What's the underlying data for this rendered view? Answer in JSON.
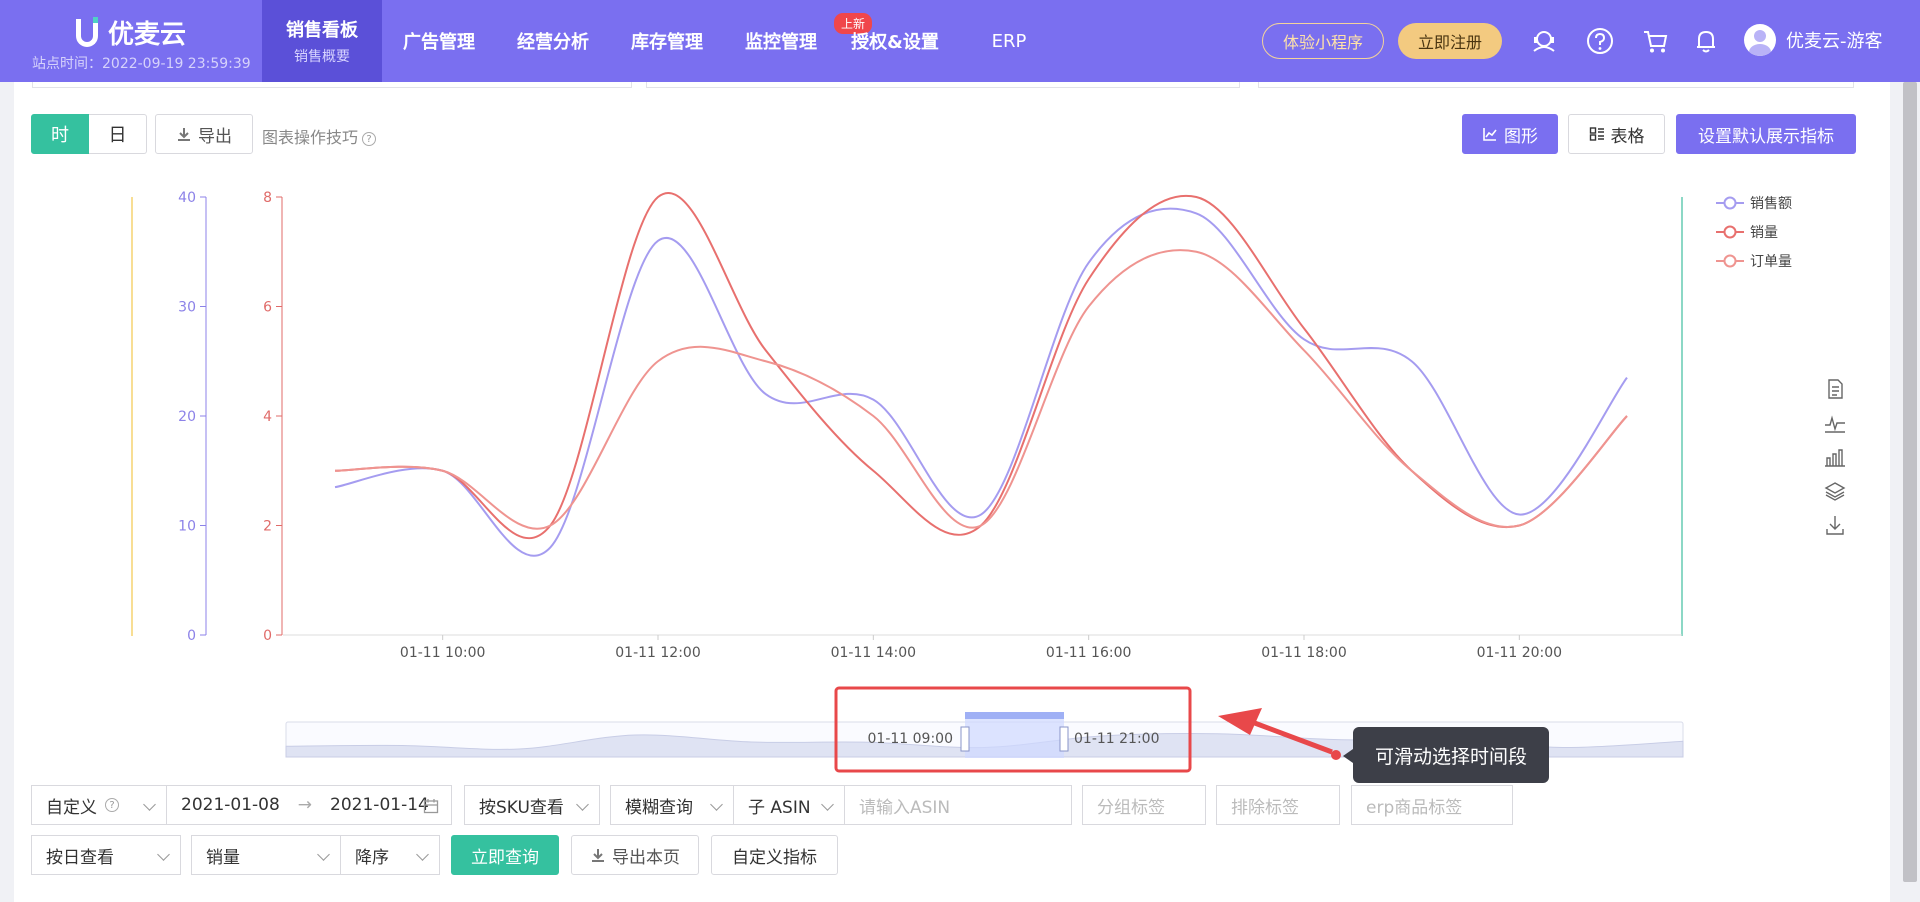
{
  "header": {
    "logo": "优麦云",
    "site_time": "站点时间：2022-09-19 23:59:39",
    "nav": [
      {
        "label": "销售看板",
        "sub": "销售概要"
      },
      {
        "label": "广告管理"
      },
      {
        "label": "经营分析"
      },
      {
        "label": "库存管理"
      },
      {
        "label": "监控管理",
        "badge": "上新"
      },
      {
        "label": "授权&设置"
      },
      {
        "label": "ERP"
      }
    ],
    "mini_program": "体验小程序",
    "register": "立即注册",
    "user": "优麦云-游客",
    "icons": [
      "headset-icon",
      "help-icon",
      "cart-icon",
      "bell-icon"
    ]
  },
  "toolbar": {
    "hour": "时",
    "day": "日",
    "export": "导出",
    "tips": "图表操作技巧",
    "graph": "图形",
    "table": "表格",
    "set_default": "设置默认展示指标"
  },
  "chart_data": {
    "type": "line",
    "x": [
      "01-11 09:00",
      "01-11 10:00",
      "01-11 11:00",
      "01-11 12:00",
      "01-11 13:00",
      "01-11 14:00",
      "01-11 15:00",
      "01-11 16:00",
      "01-11 17:00",
      "01-11 18:00",
      "01-11 19:00",
      "01-11 20:00",
      "01-11 21:00"
    ],
    "x_tick_labels": [
      "01-11 10:00",
      "01-11 12:00",
      "01-11 14:00",
      "01-11 16:00",
      "01-11 18:00",
      "01-11 20:00"
    ],
    "y_left_ticks": [
      0,
      10,
      20,
      30,
      40
    ],
    "y_right_ticks": [
      0,
      2,
      4,
      6,
      8
    ],
    "ylim_left": [
      0,
      40
    ],
    "ylim_right": [
      0,
      8
    ],
    "series": [
      {
        "name": "销售额",
        "axis": "left",
        "color": "#a59cf0",
        "values": [
          13.5,
          15,
          8,
          36,
          22,
          21.5,
          11,
          34,
          38.5,
          27,
          25,
          11,
          23.5
        ]
      },
      {
        "name": "销量",
        "axis": "right",
        "color": "#e8706e",
        "values": [
          3,
          3,
          2,
          8,
          5.2,
          3,
          2,
          6.5,
          8,
          5.6,
          3,
          2,
          4
        ]
      },
      {
        "name": "订单量",
        "axis": "right",
        "color": "#ef9490",
        "values": [
          3,
          3,
          2,
          5,
          5,
          4,
          2,
          6,
          7,
          5.2,
          3,
          2,
          4
        ]
      }
    ],
    "legend_position": "top-right"
  },
  "range_slider": {
    "start_label": "01-11 09:00",
    "end_label": "01-11 21:00",
    "tooltip": "可滑动选择时间段"
  },
  "filters": {
    "custom": "自定义",
    "date_from": "2021-01-08",
    "date_to": "2021-01-14",
    "by_sku": "按SKU查看",
    "fuzzy": "模糊查询",
    "child_asin": "子 ASIN",
    "asin_placeholder": "请输入ASIN",
    "group_tag": "分组标签",
    "exclude_tag": "排除标签",
    "erp_tag": "erp商品标签",
    "by_day": "按日查看",
    "metric": "销量",
    "order": "降序",
    "query": "立即查询",
    "export_page": "导出本页",
    "custom_metric": "自定义指标"
  }
}
